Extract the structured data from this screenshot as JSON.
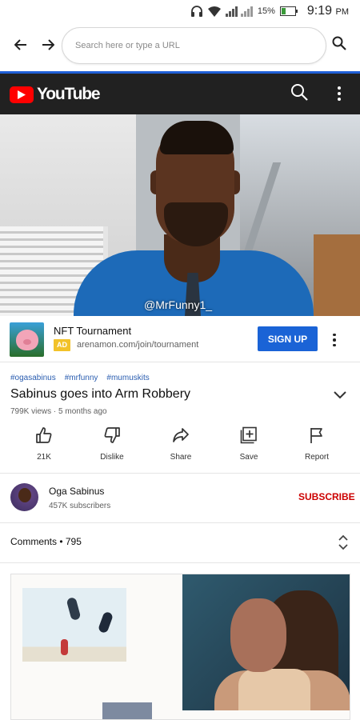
{
  "status_bar": {
    "battery_percent": "15%",
    "time": "9:19",
    "ampm": "PM"
  },
  "browser": {
    "url_placeholder": "Search here or type a URL",
    "accent_color": "#1f5fd6"
  },
  "youtube": {
    "wordmark": "YouTube",
    "brand_color": "#ff0000"
  },
  "video": {
    "watermark": "@MrFunny1_"
  },
  "ad": {
    "title": "NFT Tournament",
    "badge": "AD",
    "url": "arenamon.com/join/tournament",
    "cta": "SIGN UP"
  },
  "info": {
    "hashtags": [
      "#ogasabinus",
      "#mrfunny",
      "#mumuskits"
    ],
    "title": "Sabinus goes into Arm Robbery",
    "meta": "799K views · 5 months ago"
  },
  "actions": {
    "like": "21K",
    "dislike": "Dislike",
    "share": "Share",
    "save": "Save",
    "report": "Report"
  },
  "channel": {
    "name": "Oga Sabinus",
    "subscribers": "457K subscribers",
    "subscribe": "SUBSCRIBE"
  },
  "comments": {
    "label": "Comments • 795"
  },
  "icons": [
    "back-icon",
    "forward-icon",
    "search-icon",
    "more-vert-icon",
    "thumbs-up-icon",
    "thumbs-down-icon",
    "share-icon",
    "save-to-playlist-icon",
    "flag-icon",
    "chevron-down-icon",
    "unfold-icon"
  ]
}
